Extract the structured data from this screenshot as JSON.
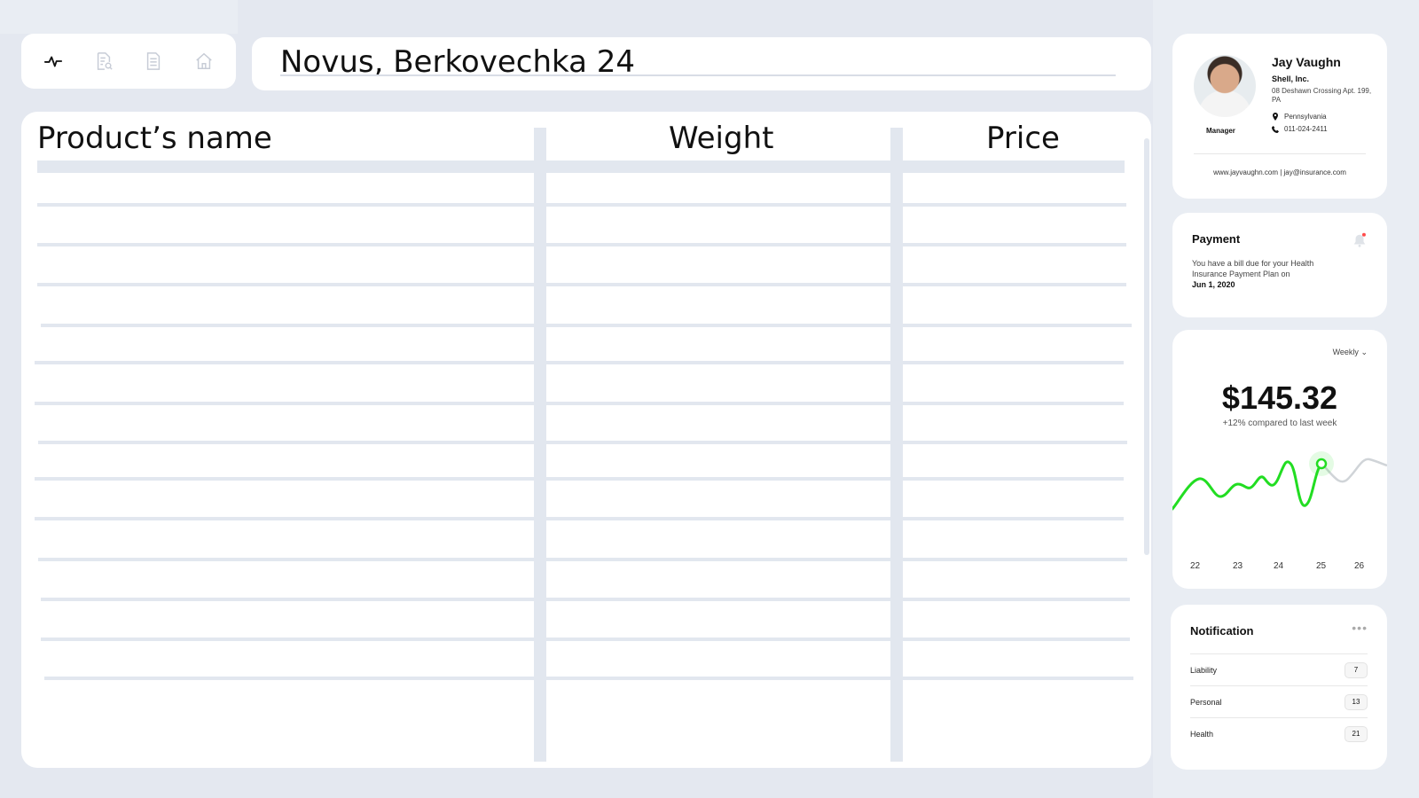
{
  "toolbar": {
    "items": [
      {
        "icon": "activity-icon"
      },
      {
        "icon": "document-search-icon"
      },
      {
        "icon": "document-icon"
      },
      {
        "icon": "home-icon"
      }
    ]
  },
  "header": {
    "title": "Novus, Berkovechka 24"
  },
  "table": {
    "columns": [
      "Product’s name",
      "Weight",
      "Price"
    ],
    "rows": []
  },
  "profile": {
    "name": "Jay Vaughn",
    "company": "Shell, Inc.",
    "address": "08 Deshawn Crossing Apt. 199, PA",
    "location": "Pennsylvania",
    "phone": "011-024-2411",
    "role": "Manager",
    "links": "www.jayvaughn.com  |  jay@insurance.com"
  },
  "payment": {
    "title": "Payment",
    "text": "You have a bill due for your Health Insurance Payment Plan on",
    "date": "Jun 1, 2020"
  },
  "earnings": {
    "period": "Weekly",
    "amount": "$145.32",
    "delta": "+12% compared to last week",
    "x_labels": [
      "22",
      "23",
      "24",
      "25",
      "26"
    ],
    "accent": "#22dd22",
    "future": "#d0d4d8"
  },
  "notifications": {
    "title": "Notification",
    "items": [
      {
        "label": "Liability",
        "count": "7"
      },
      {
        "label": "Personal",
        "count": "13"
      },
      {
        "label": "Health",
        "count": "21"
      }
    ]
  }
}
